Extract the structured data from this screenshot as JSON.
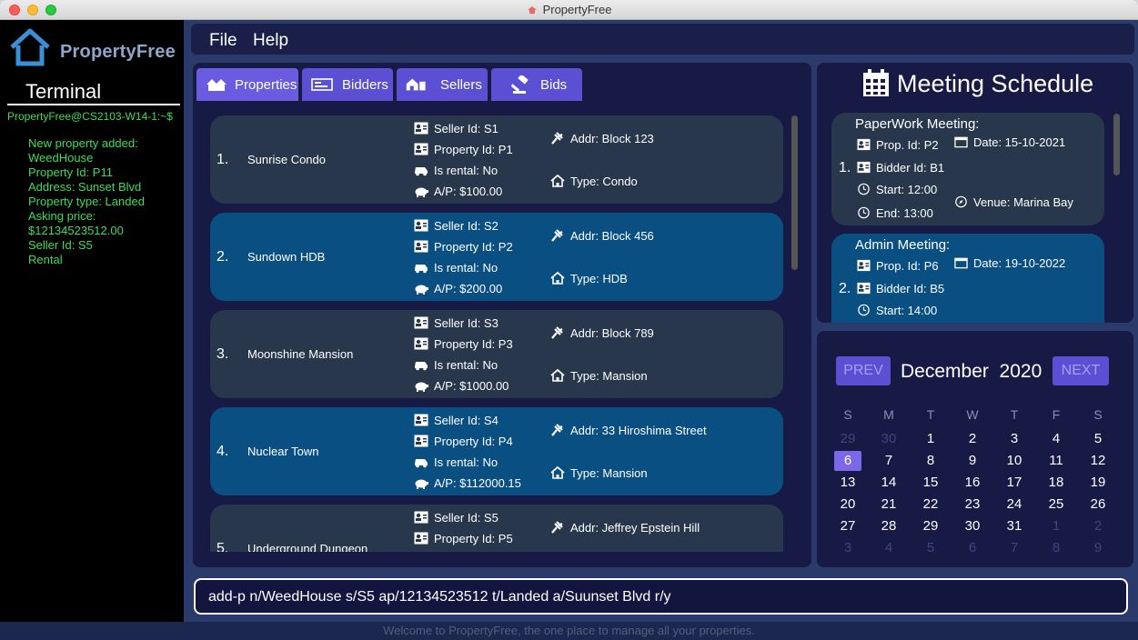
{
  "window": {
    "title": "PropertyFree"
  },
  "logo": {
    "text": "PropertyFree"
  },
  "terminal": {
    "title": "Terminal",
    "prompt": "PropertyFree@CS2103-W14-1:~$",
    "output": [
      "New property added:",
      "WeedHouse",
      "Property Id: P11",
      "Address: Sunset Blvd",
      "Property type: Landed",
      "Asking price:",
      "$12134523512.00",
      "Seller Id: S5",
      "Rental"
    ]
  },
  "menu": {
    "file": "File",
    "help": "Help"
  },
  "tabs": [
    {
      "label": "Properties",
      "icon": "house-icon"
    },
    {
      "label": "Bidders",
      "icon": "id-card-icon"
    },
    {
      "label": "Sellers",
      "icon": "farm-icon"
    },
    {
      "label": "Bids",
      "icon": "gavel-icon"
    }
  ],
  "properties": [
    {
      "index": "1.",
      "name": "Sunrise Condo",
      "seller": "Seller Id: S1",
      "pid": "Property Id: P1",
      "rental": "Is rental: No",
      "price": "A/P: $100.00",
      "addr": "Addr: Block 123",
      "type": "Type: Condo"
    },
    {
      "index": "2.",
      "name": "Sundown HDB",
      "seller": "Seller Id: S2",
      "pid": "Property Id: P2",
      "rental": "Is rental: No",
      "price": "A/P: $200.00",
      "addr": "Addr: Block 456",
      "type": "Type: HDB"
    },
    {
      "index": "3.",
      "name": "Moonshine Mansion",
      "seller": "Seller Id: S3",
      "pid": "Property Id: P3",
      "rental": "Is rental: No",
      "price": "A/P: $1000.00",
      "addr": "Addr: Block 789",
      "type": "Type: Mansion"
    },
    {
      "index": "4.",
      "name": "Nuclear Town",
      "seller": "Seller Id: S4",
      "pid": "Property Id: P4",
      "rental": "Is rental: No",
      "price": "A/P: $112000.15",
      "addr": "Addr: 33 Hiroshima Street",
      "type": "Type: Mansion"
    },
    {
      "index": "5.",
      "name": "Underground Dungeon",
      "seller": "Seller Id: S5",
      "pid": "Property Id: P5",
      "rental": "",
      "price": "",
      "addr": "Addr: Jeffrey Epstein Hill",
      "type": ""
    }
  ],
  "meetings": {
    "title": "Meeting Schedule",
    "items": [
      {
        "title": "PaperWork Meeting:",
        "index": "1.",
        "prop": "Prop. Id: P2",
        "bidder": "Bidder Id: B1",
        "start": "Start: 12:00",
        "end": "End: 13:00",
        "date": "Date: 15-10-2021",
        "venue": "Venue: Marina Bay"
      },
      {
        "title": "Admin Meeting:",
        "index": "2.",
        "prop": "Prop. Id: P6",
        "bidder": "Bidder Id: B5",
        "start": "Start: 14:00",
        "end": "",
        "date": "Date: 19-10-2022",
        "venue": ""
      }
    ]
  },
  "calendar": {
    "prev": "PREV",
    "next": "NEXT",
    "month": "December",
    "year": "2020",
    "weekdays": [
      "S",
      "M",
      "T",
      "W",
      "T",
      "F",
      "S"
    ],
    "rows": [
      [
        "29",
        "30",
        "1",
        "2",
        "3",
        "4",
        "5"
      ],
      [
        "6",
        "7",
        "8",
        "9",
        "10",
        "11",
        "12"
      ],
      [
        "13",
        "14",
        "15",
        "16",
        "17",
        "18",
        "19"
      ],
      [
        "20",
        "21",
        "22",
        "23",
        "24",
        "25",
        "26"
      ],
      [
        "27",
        "28",
        "29",
        "30",
        "31",
        "1",
        "2"
      ],
      [
        "3",
        "4",
        "5",
        "6",
        "7",
        "8",
        "9"
      ]
    ],
    "today": "6"
  },
  "command": {
    "value": "add-p n/WeedHouse s/S5 ap/12134523512 t/Landed a/Suunset Blvd r/y"
  },
  "status": {
    "text": "Welcome to PropertyFree, the one place to manage all your properties."
  },
  "colors": {
    "accent": "#5b4fd4",
    "card_dark": "#28374b",
    "card_blue": "#0a4f82",
    "terminal_green": "#3ddc5a"
  }
}
